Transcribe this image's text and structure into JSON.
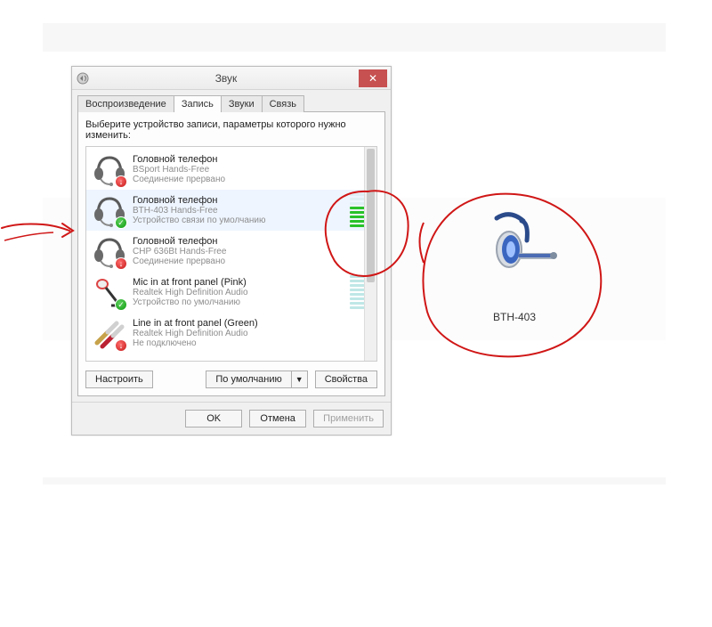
{
  "dialog": {
    "title": "Звук",
    "close": "✕",
    "tabs": [
      "Воспроизведение",
      "Запись",
      "Звуки",
      "Связь"
    ],
    "active_tab": 1,
    "instruction": "Выберите устройство записи, параметры которого нужно изменить:",
    "devices": [
      {
        "title": "Головной телефон",
        "sub": "BSport Hands-Free",
        "status": "Соединение прервано",
        "icon": "headset-icon",
        "badge": "red",
        "meter": null,
        "selected": false
      },
      {
        "title": "Головной телефон",
        "sub": "BTH-403 Hands-Free",
        "status": "Устройство связи по умолчанию",
        "icon": "headset-icon",
        "badge": "green",
        "meter": {
          "bars": 8,
          "active": 5,
          "style": "green"
        },
        "selected": true
      },
      {
        "title": "Головной телефон",
        "sub": "CHP 636Bt Hands-Free",
        "status": "Соединение прервано",
        "icon": "headset-icon",
        "badge": "red",
        "meter": null,
        "selected": false
      },
      {
        "title": "Mic in at front panel (Pink)",
        "sub": "Realtek High Definition Audio",
        "status": "Устройство по умолчанию",
        "icon": "mic-icon",
        "badge": "green",
        "meter": {
          "bars": 8,
          "active": 8,
          "style": "light"
        },
        "selected": false
      },
      {
        "title": "Line in at front panel (Green)",
        "sub": "Realtek High Definition Audio",
        "status": "Не подключено",
        "icon": "plug-icon",
        "badge": "red",
        "meter": null,
        "selected": false
      }
    ],
    "buttons": {
      "configure": "Настроить",
      "set_default": "По умолчанию",
      "properties": "Свойства",
      "ok": "OK",
      "cancel": "Отмена",
      "apply": "Применить"
    }
  },
  "side_device": {
    "label": "BTH-403"
  }
}
